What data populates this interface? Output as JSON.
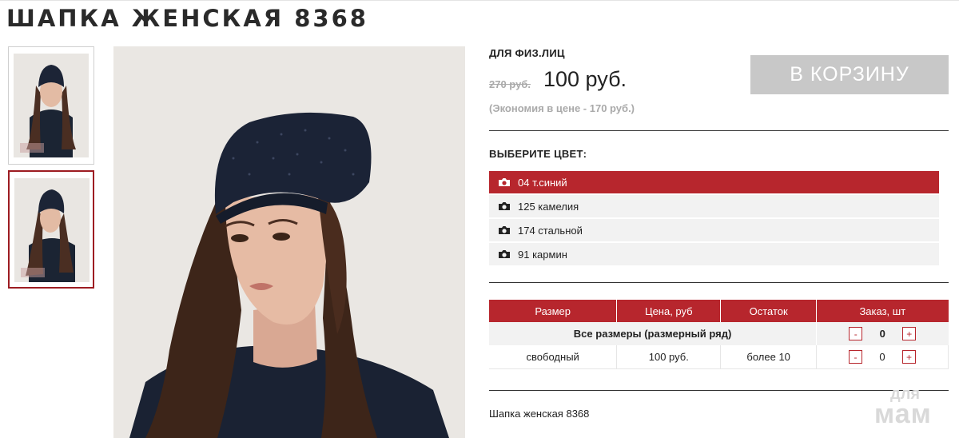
{
  "product": {
    "title": "ШАПКА ЖЕНСКАЯ 8368",
    "buyer_type": "ДЛЯ ФИЗ.ЛИЦ",
    "old_price": "270 руб.",
    "new_price": "100 руб.",
    "savings": "(Экономия в цене - 170 руб.)",
    "add_to_cart": "В КОРЗИНУ",
    "description": "Шапка женская 8368"
  },
  "gallery": {
    "selected_index": 1,
    "accent_color": "#9d1c22"
  },
  "colors": {
    "title": "ВЫБЕРИТЕ ЦВЕТ:",
    "icon": "camera-icon",
    "items": [
      {
        "label": "04 т.синий",
        "active": true
      },
      {
        "label": "125 камелия",
        "active": false
      },
      {
        "label": "174 стальной",
        "active": false
      },
      {
        "label": "91 кармин",
        "active": false
      }
    ]
  },
  "sizes_table": {
    "headers": [
      "Размер",
      "Цена, руб",
      "Остаток",
      "Заказ, шт"
    ],
    "all_sizes_label": "Все размеры (размерный ряд)",
    "all_sizes_qty": "0",
    "rows": [
      {
        "size": "свободный",
        "price": "100 руб.",
        "stock": "более 10",
        "qty": "0"
      }
    ],
    "minus": "-",
    "plus": "+"
  },
  "watermark": {
    "line1": "для",
    "line2": "мам"
  },
  "theme": {
    "accent": "#b7262d",
    "button_gray": "#c8c8c8",
    "row_bg": "#f2f2f2"
  }
}
